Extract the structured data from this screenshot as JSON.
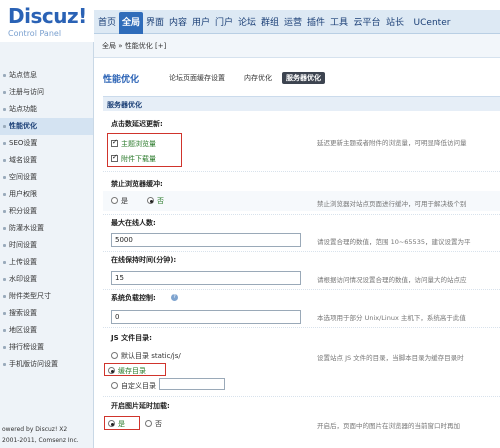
{
  "logo": {
    "brand": "Discuz!",
    "subtitle": "Control Panel"
  },
  "topnav": [
    "首页",
    "全局",
    "界面",
    "内容",
    "用户",
    "门户",
    "论坛",
    "群组",
    "运营",
    "插件",
    "工具",
    "云平台",
    "站长",
    "UCenter"
  ],
  "topnav_active": "全局",
  "breadcrumb": "全局 » 性能优化  [+]",
  "sidebar": {
    "items": [
      "站点信息",
      "注册与访问",
      "站点功能",
      "性能优化",
      "SEO设置",
      "域名设置",
      "空间设置",
      "用户权限",
      "积分设置",
      "防灌水设置",
      "时间设置",
      "上传设置",
      "水印设置",
      "附件类型尺寸",
      "搜索设置",
      "地区设置",
      "排行榜设置",
      "手机版访问设置"
    ],
    "active_index": 3,
    "footer_line1": "owered by Discuz! X2",
    "footer_line2": "2001-2011, Comsenz Inc."
  },
  "page": {
    "title": "性能优化",
    "subtabs": [
      "论坛页面缓存设置",
      "内存优化",
      "服务器优化"
    ],
    "current_subtab": "服务器优化",
    "section_title": "服务器优化"
  },
  "settings": {
    "refresh": {
      "label": "点击数延迟更新:",
      "options": [
        "主题浏览量",
        "附件下载量"
      ],
      "desc": "延迟更新主题或者附件的浏览量，可明显降低访问量"
    },
    "nocache": {
      "label": "禁止浏览器缓冲:",
      "yes": "是",
      "no": "否",
      "selected": "否",
      "desc": "禁止浏览器对站点页面进行缓冲，可用于解决极个别"
    },
    "maxonline": {
      "label": "最大在线人数:",
      "value": "5000",
      "desc": "请设置合理的数值，范围 10~65535，建议设置为平"
    },
    "onlinehold": {
      "label": "在线保持时间(分钟):",
      "value": "15",
      "desc": "请根据访问情况设置合理的数值，访问量大的站点应"
    },
    "loadctrl": {
      "label": "系统负载控制:",
      "help_icon": "help-icon",
      "value": "0",
      "desc": "本选项用于部分 Unix/Linux 主机下，系统高于此值"
    },
    "jsdir": {
      "label": "JS 文件目录:",
      "options": [
        "默认目录 static/js/",
        "缓存目录",
        "自定义目录"
      ],
      "selected": "缓存目录",
      "custom_value": "",
      "desc": "设置站点 JS 文件的目录，当脚本目录为缓存目录时"
    },
    "lazyload": {
      "label": "开启图片延时加载:",
      "yes": "是",
      "no": "否",
      "selected": "是",
      "desc": "开启后，页面中的图片在浏览器的当前窗口时再加"
    }
  },
  "colors": {
    "accent": "#2f6cba",
    "highlight_box": "#d0342c",
    "checked_text": "#2a7a2a"
  }
}
